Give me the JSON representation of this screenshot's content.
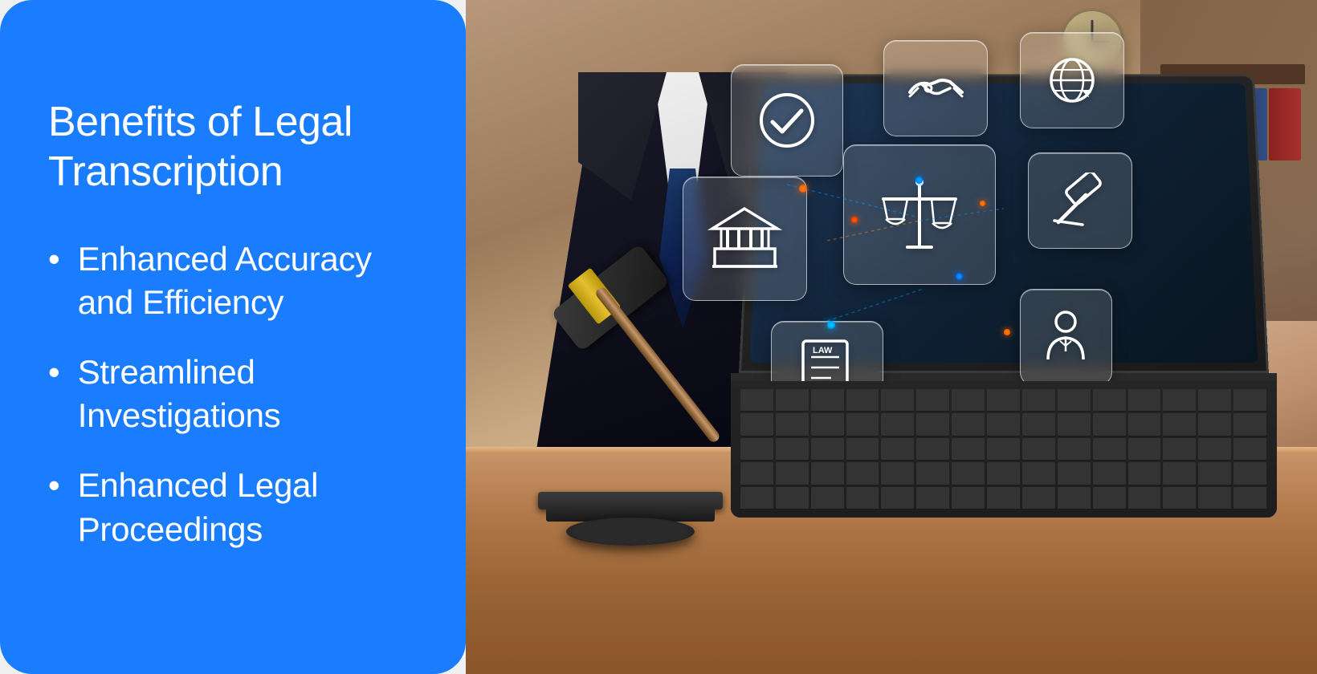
{
  "panel": {
    "title": "Benefits of Legal Transcription",
    "background_color": "#1a7dff",
    "benefits": [
      {
        "id": "benefit-1",
        "text": "Enhanced Accuracy and Efficiency"
      },
      {
        "id": "benefit-2",
        "text": "Streamlined Investigations"
      },
      {
        "id": "benefit-3",
        "text": "Enhanced Legal Proceedings"
      }
    ],
    "bullet_char": "•"
  },
  "image": {
    "alt": "Lawyer using laptop with legal icons",
    "icons": [
      {
        "id": "check-icon",
        "label": "checkmark",
        "symbol": "✓"
      },
      {
        "id": "handshake-icon",
        "label": "handshake",
        "symbol": "🤝"
      },
      {
        "id": "globe-icon",
        "label": "globe",
        "symbol": "🌐"
      },
      {
        "id": "building-icon",
        "label": "courthouse",
        "symbol": "🏛"
      },
      {
        "id": "scales-icon",
        "label": "scales of justice",
        "symbol": "⚖"
      },
      {
        "id": "gavel-icon",
        "label": "gavel",
        "symbol": "⚖"
      },
      {
        "id": "law-doc-icon",
        "label": "law document",
        "symbol": "📄"
      },
      {
        "id": "person-icon",
        "label": "person",
        "symbol": "👤"
      }
    ]
  }
}
